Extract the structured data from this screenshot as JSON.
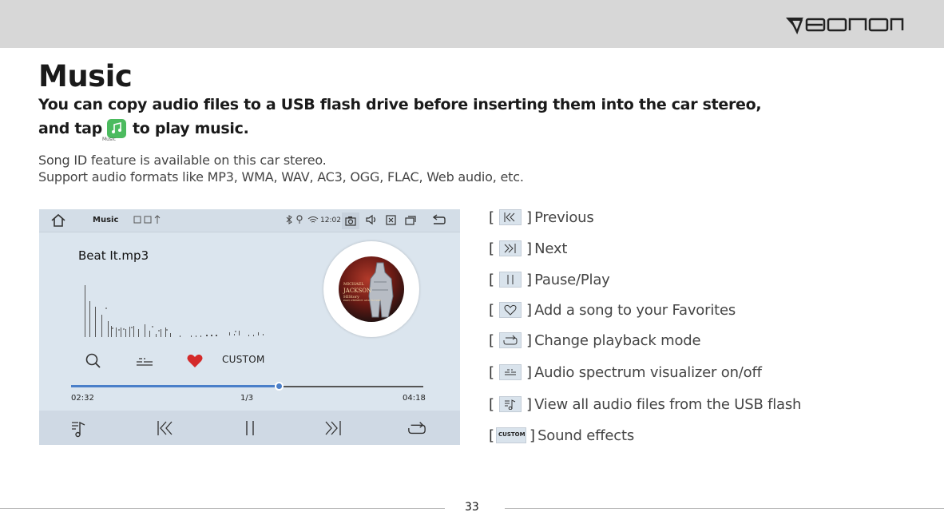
{
  "brand": {
    "logo_text": "EONON"
  },
  "heading": {
    "title": "Music",
    "lead_line1": "You can copy audio files to a USB flash drive before inserting them into the car stereo,",
    "lead_line2_before": "and tap",
    "lead_line2_after": "to play music.",
    "app_icon_caption": "Music"
  },
  "notes": [
    "Song ID feature is available on this car stereo.",
    "Support audio formats like MP3, WMA, WAV, AC3, OGG, FLAC, Web audio, etc."
  ],
  "device": {
    "statusbar": {
      "app_label": "Music",
      "clock": "12:02"
    },
    "song_title": "Beat It.mp3",
    "album_art_text": [
      "MICHAEL",
      "JACKSON",
      "HIStory",
      "PAST, PRESENT AND FUTURE"
    ],
    "sound_effect_label": "CUSTOM",
    "progress": {
      "fraction": 0.59,
      "elapsed": "02:32",
      "track": "1/3",
      "total": "04:18"
    },
    "icons": {
      "status": [
        "home-icon",
        "usb-icon",
        "bluetooth-icon",
        "location-icon",
        "wifi-icon",
        "camera-icon",
        "volume-icon",
        "close-box-icon",
        "windows-icon",
        "back-icon"
      ],
      "controls": [
        "search-icon",
        "spectrum-icon",
        "heart-icon"
      ],
      "bottom": [
        "playlist-icon",
        "previous-icon",
        "pause-icon",
        "next-icon",
        "repeat-icon"
      ]
    },
    "colors": {
      "accent": "#4a7fc9",
      "heart": "#d42a2a",
      "screen_bg": "#dbe5ee"
    }
  },
  "legend": [
    {
      "icon": "previous-icon",
      "label": "Previous"
    },
    {
      "icon": "next-icon",
      "label": "Next"
    },
    {
      "icon": "pause-icon",
      "label": "Pause/Play"
    },
    {
      "icon": "heart-icon",
      "label": "Add a song to your Favorites"
    },
    {
      "icon": "repeat-icon",
      "label": "Change playback mode"
    },
    {
      "icon": "spectrum-icon",
      "label": "Audio spectrum visualizer on/off"
    },
    {
      "icon": "playlist-icon",
      "label": "View all audio files from the USB flash"
    },
    {
      "icon": "custom-badge",
      "badge": "CUSTOM",
      "label": "Sound effects"
    }
  ],
  "footer": {
    "page_number": "33"
  }
}
